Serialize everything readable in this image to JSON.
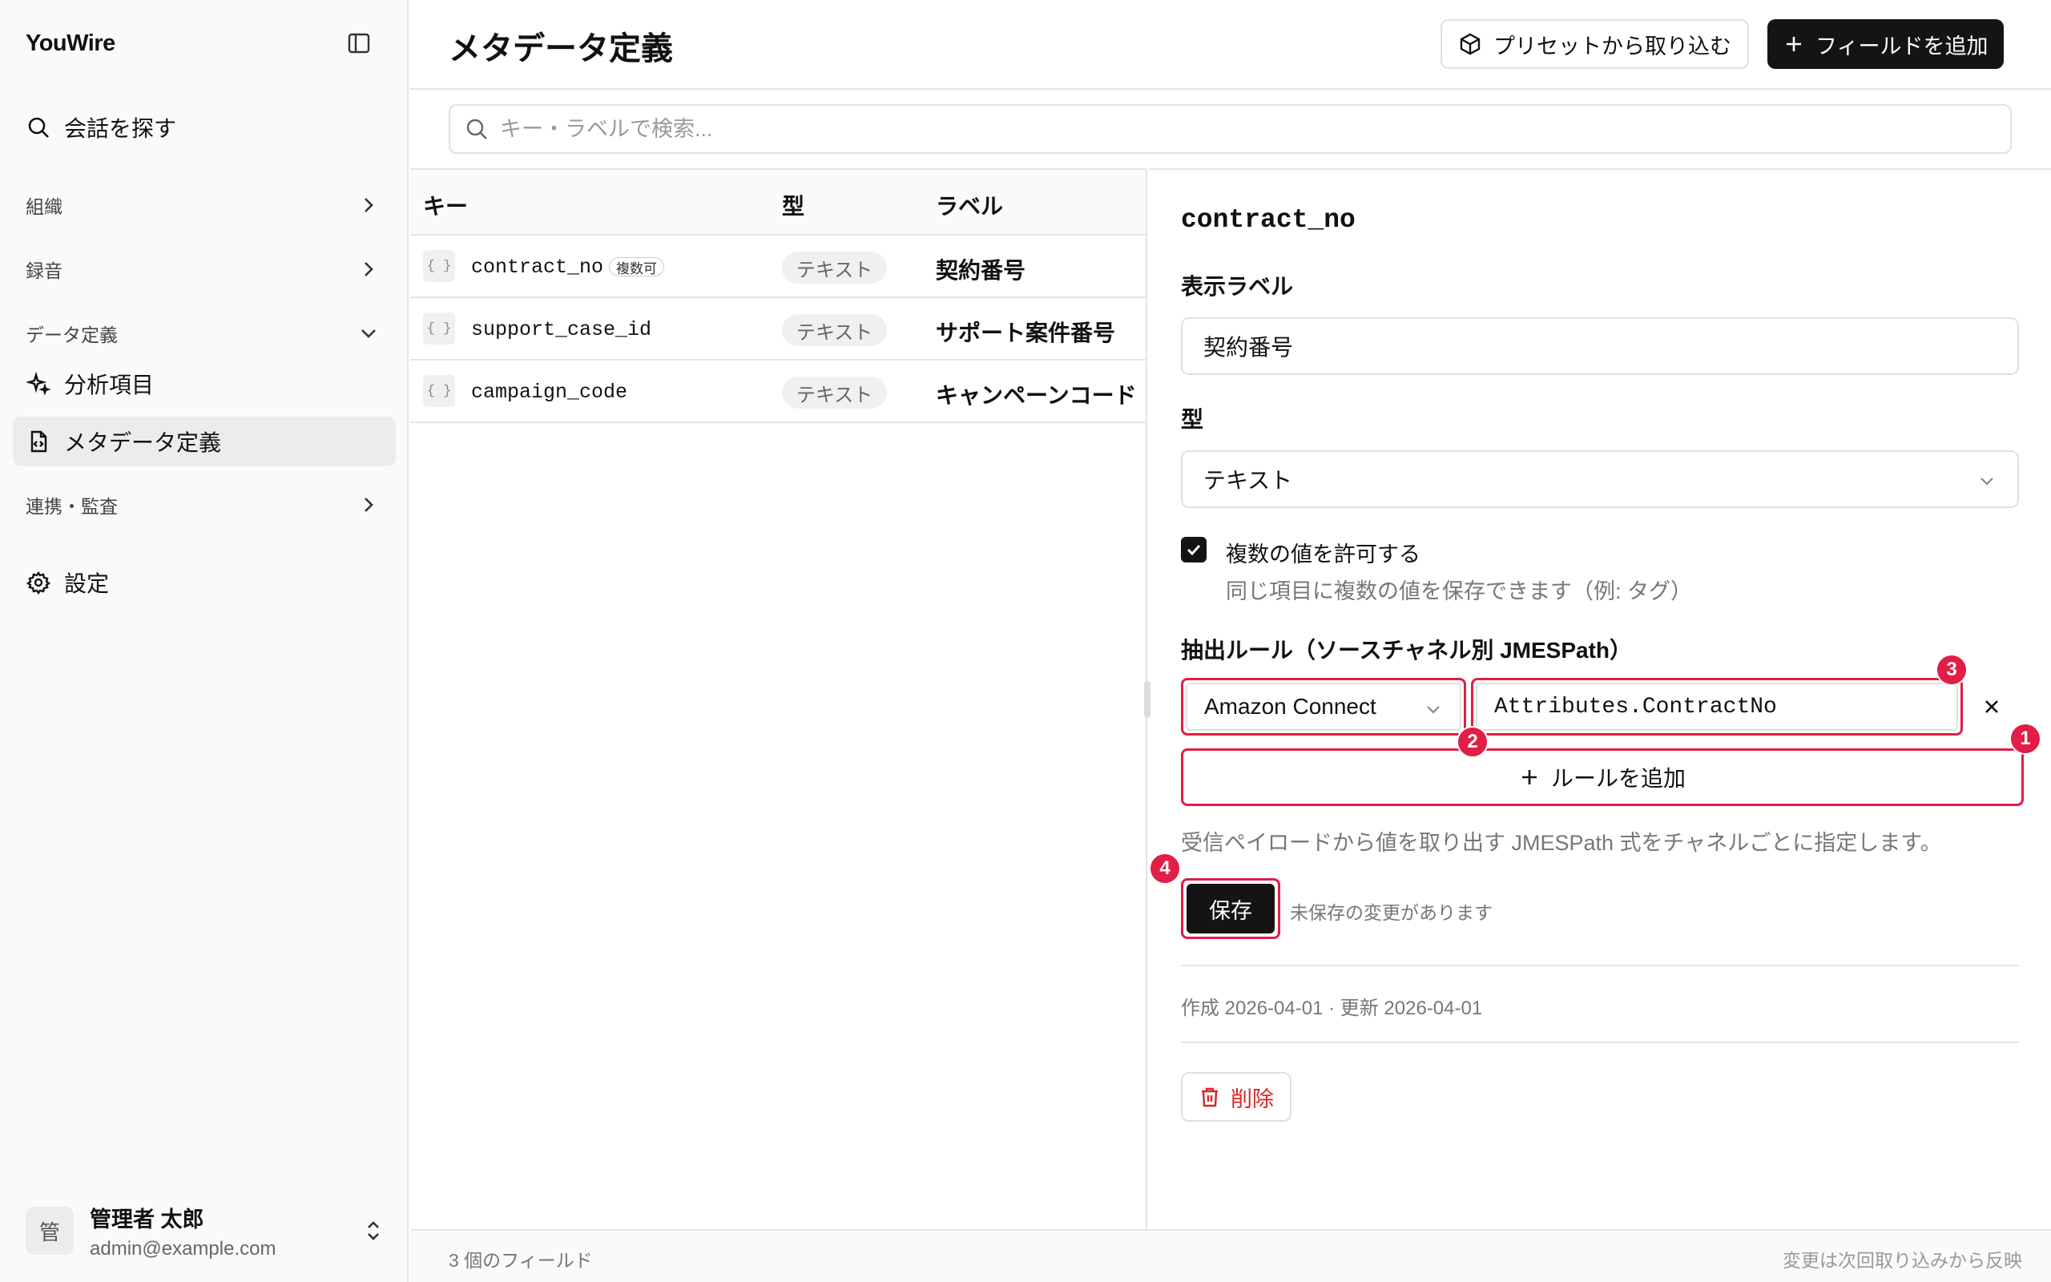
{
  "sidebar": {
    "brand": "YouWire",
    "search_label": "会話を探す",
    "sections": {
      "org": "組織",
      "recording": "録音",
      "data_def": "データ定義",
      "integration": "連携・監査"
    },
    "items": {
      "analysis": "分析項目",
      "metadata": "メタデータ定義",
      "settings": "設定"
    },
    "user": {
      "avatar": "管",
      "name": "管理者 太郎",
      "email": "admin@example.com"
    }
  },
  "header": {
    "title": "メタデータ定義",
    "import_label": "プリセットから取り込む",
    "add_label": "フィールドを追加"
  },
  "search": {
    "placeholder": "キー・ラベルで検索..."
  },
  "table": {
    "columns": {
      "key": "キー",
      "type": "型",
      "label": "ラベル"
    },
    "rows": [
      {
        "icon": "{ }",
        "key": "contract_no",
        "badge": "複数可",
        "type": "テキスト",
        "label": "契約番号"
      },
      {
        "icon": "{ }",
        "key": "support_case_id",
        "badge": "",
        "type": "テキスト",
        "label": "サポート案件番号"
      },
      {
        "icon": "{ }",
        "key": "campaign_code",
        "badge": "",
        "type": "テキスト",
        "label": "キャンペーンコード"
      }
    ]
  },
  "detail": {
    "title": "contract_no",
    "display_label_title": "表示ラベル",
    "display_label_value": "契約番号",
    "type_title": "型",
    "type_value": "テキスト",
    "multi_label": "複数の値を許可する",
    "multi_help": "同じ項目に複数の値を保存できます（例: タグ）",
    "multi_checked": true,
    "rules_title": "抽出ルール（ソースチャネル別 JMESPath）",
    "rule_source": "Amazon Connect",
    "rule_path": "Attributes.ContractNo",
    "add_rule_label": "ルールを追加",
    "rules_help": "受信ペイロードから値を取り出す JMESPath 式をチャネルごとに指定します。",
    "save_label": "保存",
    "unsaved_note": "未保存の変更があります",
    "meta": "作成 2026-04-01 · 更新 2026-04-01",
    "delete_label": "削除"
  },
  "markers": {
    "m1": "1",
    "m2": "2",
    "m3": "3",
    "m4": "4"
  },
  "footer": {
    "count": "3 個のフィールド",
    "note": "変更は次回取り込みから反映"
  },
  "colors": {
    "accent": "#141414",
    "highlight": "#e11d48",
    "danger": "#dc2626"
  }
}
